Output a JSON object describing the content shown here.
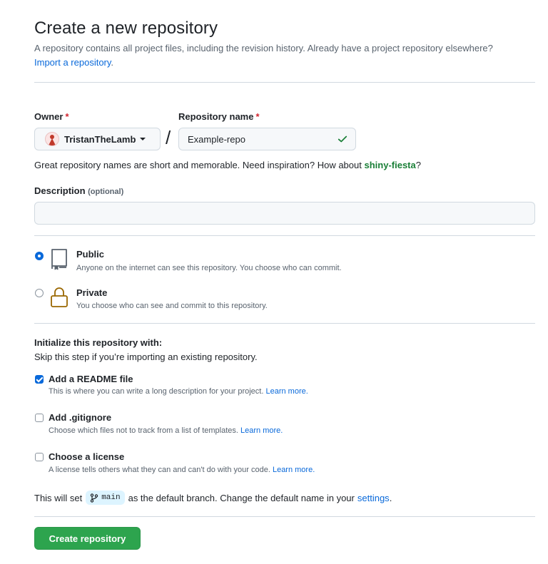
{
  "header": {
    "title": "Create a new repository",
    "subtitle_text": "A repository contains all project files, including the revision history. Already have a project repository elsewhere?",
    "import_link": "Import a repository",
    "subtitle_end": "."
  },
  "owner": {
    "label": "Owner",
    "required_mark": "*",
    "value": "TristanTheLamb",
    "icon": "caret-down-icon"
  },
  "separator": "/",
  "repo_name": {
    "label": "Repository name",
    "required_mark": "*",
    "value": "Example-repo",
    "valid_icon": "check-icon"
  },
  "name_hint": {
    "text": "Great repository names are short and memorable. Need inspiration? How about",
    "suggestion": "shiny-fiesta",
    "end": "?"
  },
  "description": {
    "label": "Description",
    "optional": "(optional)",
    "value": ""
  },
  "visibility": [
    {
      "title": "Public",
      "desc": "Anyone on the internet can see this repository. You choose who can commit.",
      "selected": true,
      "icon": "repo-icon"
    },
    {
      "title": "Private",
      "desc": "You choose who can see and commit to this repository.",
      "selected": false,
      "icon": "lock-icon"
    }
  ],
  "init": {
    "title": "Initialize this repository with:",
    "subtitle": "Skip this step if you’re importing an existing repository.",
    "options": [
      {
        "title": "Add a README file",
        "desc": "This is where you can write a long description for your project.",
        "link": "Learn more.",
        "checked": true
      },
      {
        "title": "Add .gitignore",
        "desc": "Choose which files not to track from a list of templates.",
        "link": "Learn more.",
        "checked": false
      },
      {
        "title": "Choose a license",
        "desc": "A license tells others what they can and can't do with your code.",
        "link": "Learn more.",
        "checked": false
      }
    ]
  },
  "branch": {
    "prefix": "This will set",
    "name": "main",
    "middle": "as the default branch. Change the default name in your",
    "settings_link": "settings",
    "end": "."
  },
  "submit_label": "Create repository",
  "colors": {
    "link": "#0969da",
    "success": "#1a7f37",
    "primary_button": "#2da44e",
    "required": "#d1242f",
    "private_icon": "#9a6700"
  }
}
